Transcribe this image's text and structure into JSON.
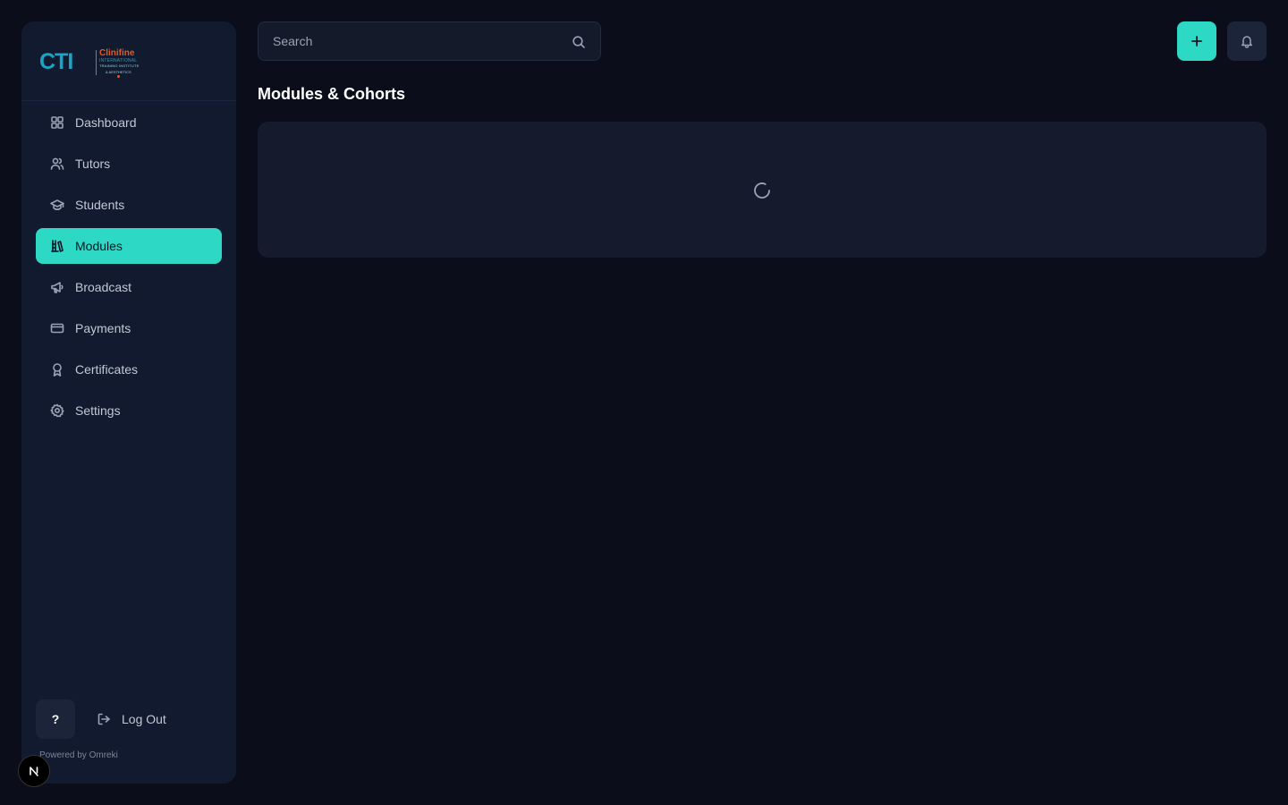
{
  "logo": {
    "mark": "CTI",
    "brand": "Clinifine",
    "line1": "INTERNATIONAL",
    "line2": "TRAINING INSTITUTE",
    "line3": "& AESTHETICS"
  },
  "sidebar": {
    "items": [
      {
        "label": "Dashboard",
        "icon": "grid-icon"
      },
      {
        "label": "Tutors",
        "icon": "users-icon"
      },
      {
        "label": "Students",
        "icon": "graduation-cap-icon"
      },
      {
        "label": "Modules",
        "icon": "library-icon",
        "active": true
      },
      {
        "label": "Broadcast",
        "icon": "megaphone-icon"
      },
      {
        "label": "Payments",
        "icon": "credit-card-icon"
      },
      {
        "label": "Certificates",
        "icon": "award-icon"
      },
      {
        "label": "Settings",
        "icon": "gear-icon"
      }
    ],
    "help_label": "?",
    "logout_label": "Log Out",
    "powered_by": "Powered by Omreki"
  },
  "header": {
    "search_placeholder": "Search"
  },
  "main": {
    "title": "Modules & Cohorts"
  },
  "colors": {
    "accent": "#2dd9c5",
    "background": "#0b0e1a",
    "sidebar": "#111a2e",
    "logo_orange": "#e65a1e",
    "logo_blue": "#1aa3c4"
  }
}
